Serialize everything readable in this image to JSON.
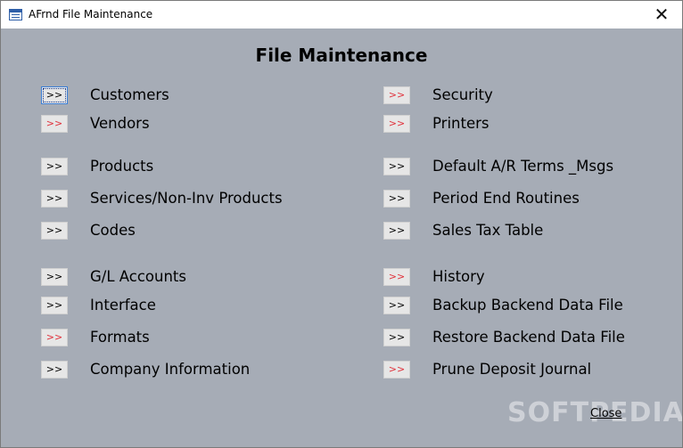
{
  "window": {
    "title": "AFrnd File Maintenance",
    "close_glyph": "✕"
  },
  "heading": "File Maintenance",
  "button_glyph": ">>",
  "colors": {
    "background": "#a6acb6",
    "button_face": "#e6e6e6",
    "red_glyph": "#e0303a"
  },
  "left_items": [
    {
      "label": "Customers"
    },
    {
      "label": "Vendors"
    },
    {
      "label": "Products"
    },
    {
      "label": "Services/Non-Inv Products"
    },
    {
      "label": "Codes"
    },
    {
      "label": "G/L Accounts"
    },
    {
      "label": "Interface"
    },
    {
      "label": "Formats"
    },
    {
      "label": "Company Information"
    }
  ],
  "right_items": [
    {
      "label": "Security"
    },
    {
      "label": "Printers"
    },
    {
      "label": "Default A/R Terms _Msgs"
    },
    {
      "label": "Period End Routines"
    },
    {
      "label": "Sales Tax Table"
    },
    {
      "label": "History"
    },
    {
      "label": "Backup Backend Data File"
    },
    {
      "label": "Restore Backend Data File"
    },
    {
      "label": "Prune Deposit Journal"
    }
  ],
  "close_button": {
    "label": "Close"
  },
  "watermark": {
    "text": "SOFTPEDIA",
    "mark": "®"
  }
}
